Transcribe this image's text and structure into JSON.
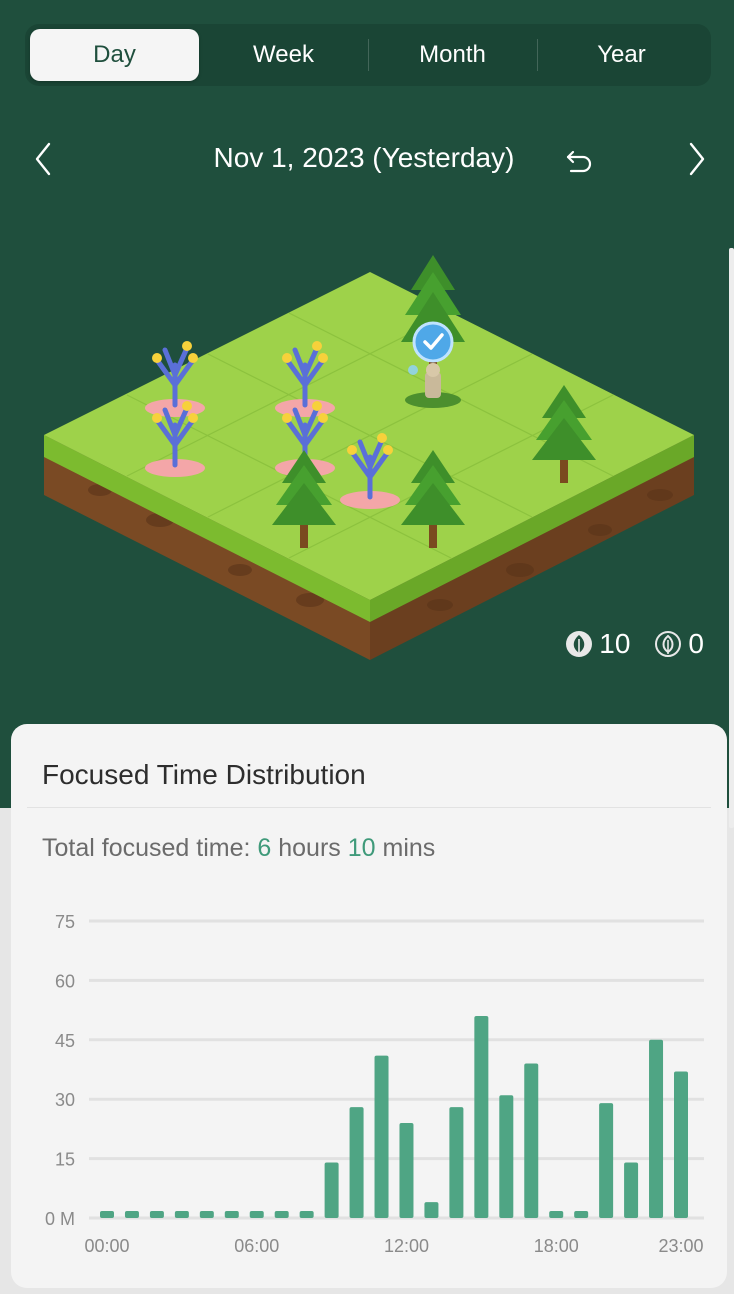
{
  "tabs": [
    {
      "label": "Day",
      "active": true
    },
    {
      "label": "Week",
      "active": false
    },
    {
      "label": "Month",
      "active": false
    },
    {
      "label": "Year",
      "active": false
    }
  ],
  "date_bar": {
    "title": "Nov 1, 2023 (Yesterday)",
    "prev_icon": "chevron-left-icon",
    "next_icon": "chevron-right-icon",
    "reset_icon": "undo-icon"
  },
  "forest_counts": {
    "healthy": "10",
    "withered": "0"
  },
  "card": {
    "title": "Focused Time Distribution",
    "total_prefix": "Total focused time: ",
    "hours": "6",
    "hours_unit": " hours ",
    "mins": "10",
    "mins_unit": " mins"
  },
  "colors": {
    "header_bg": "#1f4f3d",
    "accent": "#3f9a7a",
    "bar": "#4fa584",
    "card_bg": "#f4f4f4"
  },
  "chart_data": {
    "type": "bar",
    "categories": [
      "0",
      "1",
      "2",
      "3",
      "4",
      "5",
      "6",
      "7",
      "8",
      "9",
      "10",
      "11",
      "12",
      "13",
      "14",
      "15",
      "16",
      "17",
      "18",
      "19",
      "20",
      "21",
      "22",
      "23"
    ],
    "values": [
      0,
      0,
      0,
      0,
      0,
      0,
      0,
      0,
      0,
      14,
      28,
      41,
      24,
      4,
      28,
      51,
      31,
      39,
      0,
      0,
      29,
      14,
      45,
      37
    ],
    "y_ticks": [
      "0 M",
      "15",
      "30",
      "45",
      "60",
      "75"
    ],
    "x_tick_labels": [
      "00:00",
      "06:00",
      "12:00",
      "18:00",
      "23:00"
    ],
    "ylim": [
      0,
      75
    ],
    "grid": true
  }
}
